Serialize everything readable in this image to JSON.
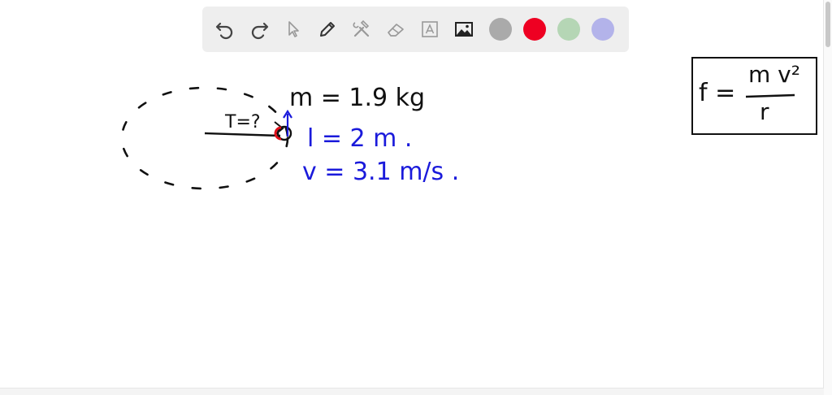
{
  "toolbar": {
    "tools": [
      {
        "name": "undo-icon"
      },
      {
        "name": "redo-icon"
      },
      {
        "name": "select-pointer-icon"
      },
      {
        "name": "pen-icon"
      },
      {
        "name": "tools-icon"
      },
      {
        "name": "eraser-icon"
      },
      {
        "name": "text-box-icon"
      },
      {
        "name": "image-icon"
      }
    ],
    "colors": [
      "#aaaaaa",
      "#ee0022",
      "#b5d6b5",
      "#b3b3ea"
    ]
  },
  "whiteboard": {
    "tension_label": "T=?",
    "mass": "m = 1.9 kg",
    "length": "l = 2 m .",
    "speed": "v = 3.1 m/s .",
    "formula": {
      "lhs": "f =",
      "numerator": "m v²",
      "denominator": "r"
    }
  }
}
